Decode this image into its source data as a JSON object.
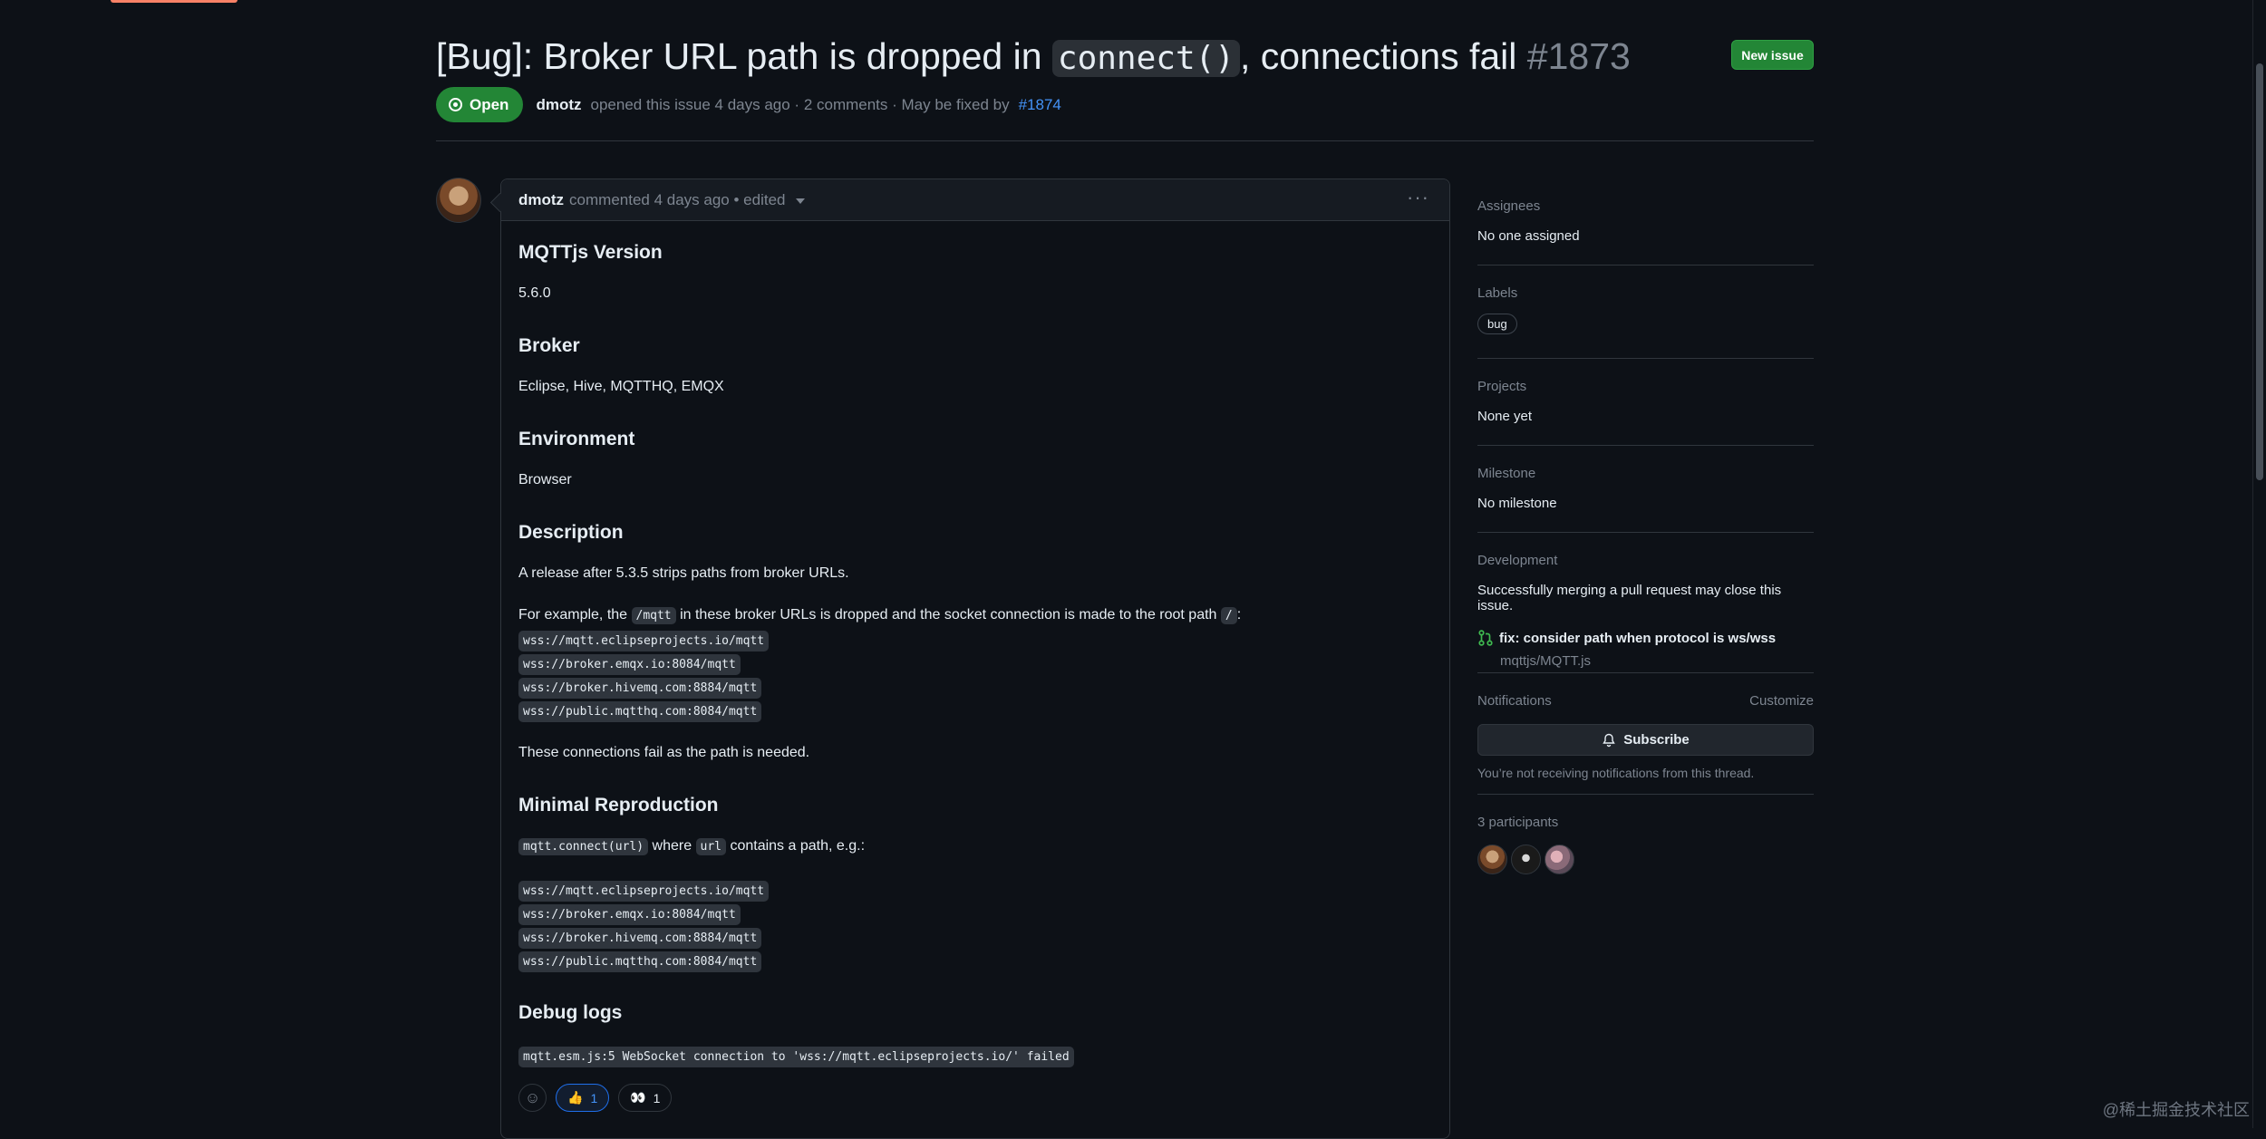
{
  "issue": {
    "title_prefix": "[Bug]: Broker URL path is dropped in ",
    "title_code": "connect()",
    "title_suffix": ", connections fail",
    "number": "#1873",
    "state": "Open",
    "author": "dmotz",
    "meta_opened": "opened this issue 4 days ago · 2 comments · May be fixed by",
    "fixed_by": "#1874"
  },
  "header": {
    "new_issue_label": "New issue"
  },
  "comment": {
    "author": "dmotz",
    "meta": "commented 4 days ago • edited",
    "sections": {
      "version_heading": "MQTTjs Version",
      "version_value": "5.6.0",
      "broker_heading": "Broker",
      "broker_value": "Eclipse, Hive, MQTTHQ, EMQX",
      "env_heading": "Environment",
      "env_value": "Browser",
      "desc_heading": "Description",
      "desc_p1": "A release after 5.3.5 strips paths from broker URLs.",
      "desc_p2_a": "For example, the ",
      "desc_p2_code1": "/mqtt",
      "desc_p2_b": " in these broker URLs is dropped and the socket connection is made to the root path ",
      "desc_p2_code2": "/",
      "desc_p2_c": ":",
      "desc_p3": "These connections fail as the path is needed.",
      "repro_heading": "Minimal Reproduction",
      "repro_code1": "mqtt.connect(url)",
      "repro_a": " where ",
      "repro_code2": "url",
      "repro_b": " contains a path, e.g.:",
      "debug_heading": "Debug logs",
      "debug_code": "mqtt.esm.js:5 WebSocket connection to 'wss://mqtt.eclipseprojects.io/' failed"
    },
    "urls": [
      "wss://mqtt.eclipseprojects.io/mqtt",
      "wss://broker.emqx.io:8084/mqtt",
      "wss://broker.hivemq.com:8884/mqtt",
      "wss://public.mqtthq.com:8084/mqtt"
    ],
    "reactions": [
      {
        "emoji": "👍",
        "count": "1"
      },
      {
        "emoji": "👀",
        "count": "1"
      }
    ]
  },
  "sidebar": {
    "assignees_label": "Assignees",
    "assignees_value": "No one assigned",
    "labels_label": "Labels",
    "label_bug": "bug",
    "projects_label": "Projects",
    "projects_value": "None yet",
    "milestone_label": "Milestone",
    "milestone_value": "No milestone",
    "development_label": "Development",
    "development_note": "Successfully merging a pull request may close this issue.",
    "development_pr": "fix: consider path when protocol is ws/wss",
    "development_repo": "mqttjs/MQTT.js",
    "notifications_label": "Notifications",
    "customize_label": "Customize",
    "subscribe_label": "Subscribe",
    "notifications_note": "You’re not receiving notifications from this thread.",
    "participants_label": "3 participants"
  },
  "watermark": "@稀土掘金技术社区",
  "colors": {
    "open_green": "#238636",
    "link_blue": "#4493f8",
    "background": "#0d1117"
  }
}
